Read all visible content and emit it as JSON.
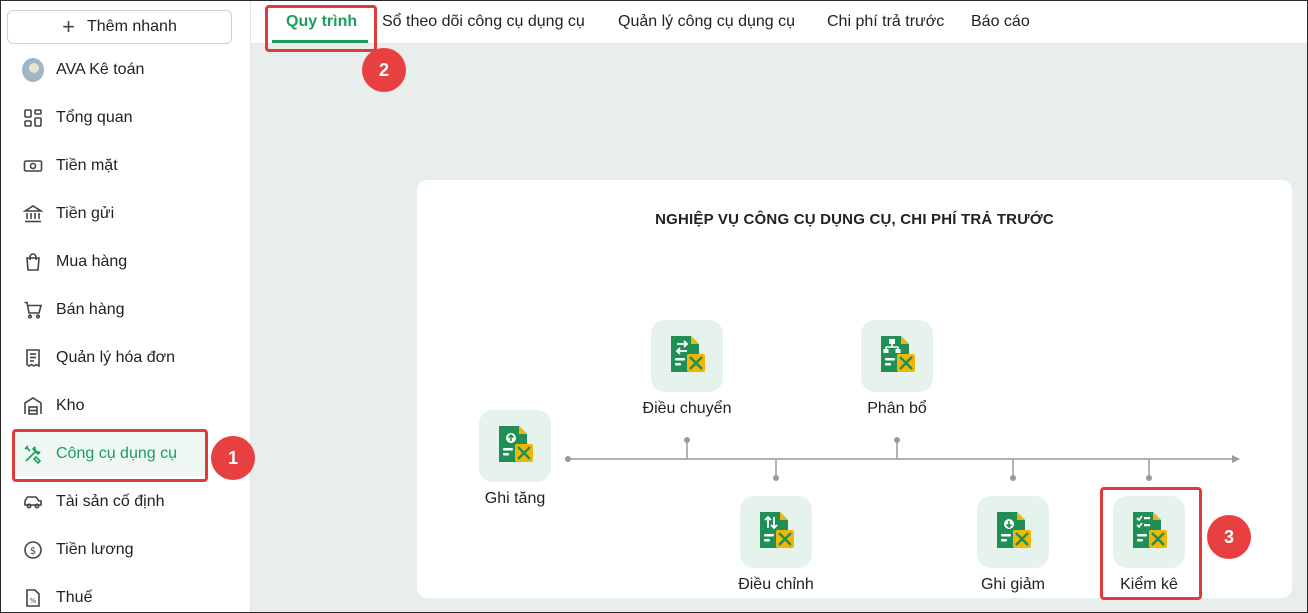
{
  "sidebar": {
    "quick_add": "Thêm nhanh",
    "items": [
      {
        "label": "AVA Kê toán",
        "icon": "avatar-icon"
      },
      {
        "label": "Tổng quan",
        "icon": "dashboard-icon"
      },
      {
        "label": "Tiền mặt",
        "icon": "cash-icon"
      },
      {
        "label": "Tiền gửi",
        "icon": "bank-icon"
      },
      {
        "label": "Mua hàng",
        "icon": "shopping-bag-icon"
      },
      {
        "label": "Bán hàng",
        "icon": "cart-icon"
      },
      {
        "label": "Quản lý hóa đơn",
        "icon": "invoice-icon"
      },
      {
        "label": "Kho",
        "icon": "warehouse-icon"
      },
      {
        "label": "Công cụ dụng cụ",
        "icon": "tools-icon"
      },
      {
        "label": "Tài sản cố định",
        "icon": "car-icon"
      },
      {
        "label": "Tiền lương",
        "icon": "dollar-icon"
      },
      {
        "label": "Thuế",
        "icon": "tax-icon"
      }
    ]
  },
  "tabs": [
    {
      "label": "Quy trình"
    },
    {
      "label": "Sổ theo dõi công cụ dụng cụ"
    },
    {
      "label": "Quản lý công cụ dụng cụ"
    },
    {
      "label": "Chi phí trả trước"
    },
    {
      "label": "Báo cáo"
    }
  ],
  "process": {
    "title": "NGHIỆP VỤ CÔNG CỤ DỤNG CỤ, CHI PHÍ TRẢ TRƯỚC",
    "nodes": [
      {
        "label": "Ghi tăng",
        "icon": "increase-tool-icon"
      },
      {
        "label": "Điều chuyển",
        "icon": "transfer-tool-icon"
      },
      {
        "label": "Điều chỉnh",
        "icon": "adjust-tool-icon"
      },
      {
        "label": "Phân bổ",
        "icon": "allocate-tool-icon"
      },
      {
        "label": "Ghi giảm",
        "icon": "decrease-tool-icon"
      },
      {
        "label": "Kiểm kê",
        "icon": "inventory-check-icon"
      }
    ]
  },
  "annotations": {
    "badge1": "1",
    "badge2": "2",
    "badge3": "3"
  },
  "colors": {
    "accent": "#1a9e5c",
    "highlight": "#e03a3a",
    "icon_green": "#1f8f55",
    "icon_yellow": "#f2b705"
  }
}
